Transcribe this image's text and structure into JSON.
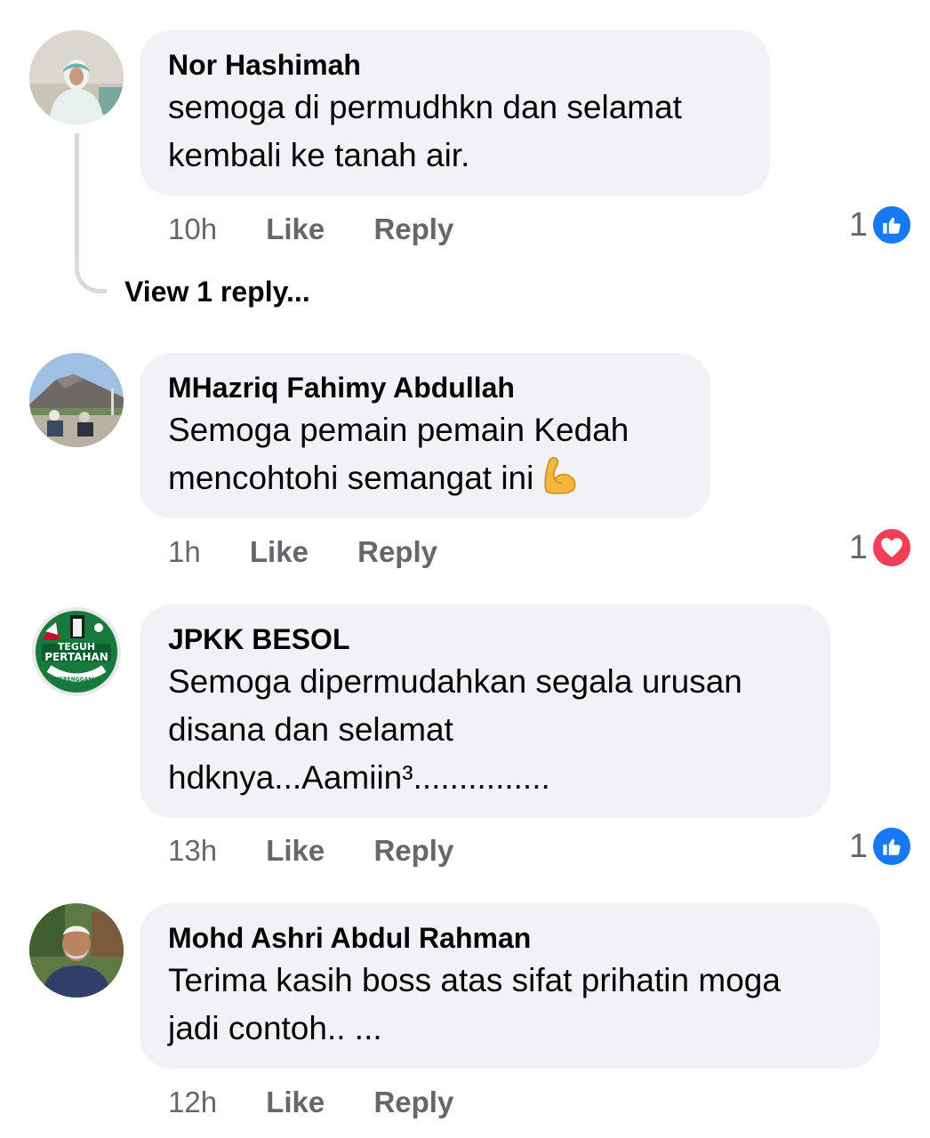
{
  "comments": [
    {
      "author": "Nor Hashimah",
      "lines": [
        "semoga di permudhkn dan selamat",
        "kembali ke tanah air."
      ],
      "time": "10h",
      "like_label": "Like",
      "reply_label": "Reply",
      "reaction_count": "1",
      "reaction_type": "like-icon",
      "reaction_color": "#1877f2"
    },
    {
      "author": "MHazriq Fahimy Abdullah",
      "lines": [
        "Semoga pemain pemain  Kedah",
        "mencohtohi semangat ini"
      ],
      "emoji": "flexed-biceps-emoji",
      "time": "1h",
      "like_label": "Like",
      "reply_label": "Reply",
      "reaction_count": "1",
      "reaction_type": "love-icon",
      "reaction_color": "#f33e58"
    },
    {
      "author": "JPKK BESOL",
      "lines": [
        "Semoga dipermudahkan segala urusan",
        "disana dan selamat",
        "hdknya...Aamiin³..............."
      ],
      "time": "13h",
      "like_label": "Like",
      "reply_label": "Reply",
      "reaction_count": "1",
      "reaction_type": "like-icon",
      "reaction_color": "#1877f2",
      "avatar_text": [
        "TEGUH",
        "PERTAHAN",
        "TERENGGANU"
      ]
    },
    {
      "author": "Mohd Ashri Abdul Rahman",
      "lines": [
        "Terima kasih boss atas sifat prihatin moga",
        "jadi contoh.. ..."
      ],
      "time": "12h",
      "like_label": "Like",
      "reply_label": "Reply"
    }
  ],
  "view_replies_label": "View 1 reply..."
}
